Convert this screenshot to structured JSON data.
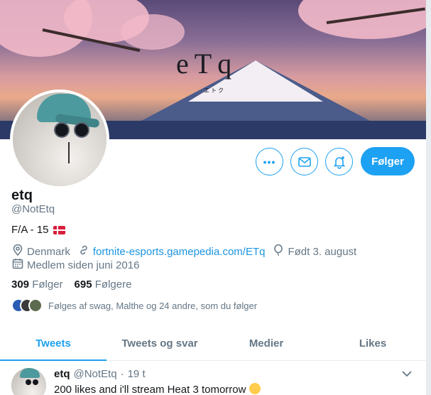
{
  "banner": {
    "title": "eTq",
    "subtitle": "エトク"
  },
  "profile": {
    "name": "etq",
    "handle": "@NotEtq",
    "bio": "F/A - 15",
    "location": "Denmark",
    "website": "fortnite-esports.gamepedia.com/ETq",
    "birthday": "Født 3. august",
    "joined": "Medlem siden juni 2016",
    "following_count": "309",
    "following_label": "Følger",
    "followers_count": "695",
    "followers_label": "Følgere",
    "followed_by": "Følges af swag, Malthe og 24 andre, som du følger"
  },
  "actions": {
    "follow_label": "Følger"
  },
  "tabs": [
    {
      "label": "Tweets",
      "active": true
    },
    {
      "label": "Tweets og svar",
      "active": false
    },
    {
      "label": "Medier",
      "active": false
    },
    {
      "label": "Likes",
      "active": false
    }
  ],
  "tweet": {
    "name": "etq",
    "handle": "@NotEtq",
    "separator": "·",
    "time": "19 t",
    "text": "200 likes and i'll stream Heat 3 tomorrow"
  },
  "icons": {
    "more": "more-icon",
    "message": "envelope-icon",
    "notifications": "bell-plus-icon",
    "location": "location-pin-icon",
    "link": "link-icon",
    "birthday": "balloon-icon",
    "calendar": "calendar-icon"
  },
  "colors": {
    "accent": "#1da1f2",
    "link": "#1b95e0",
    "muted": "#657786",
    "text": "#14171a"
  }
}
